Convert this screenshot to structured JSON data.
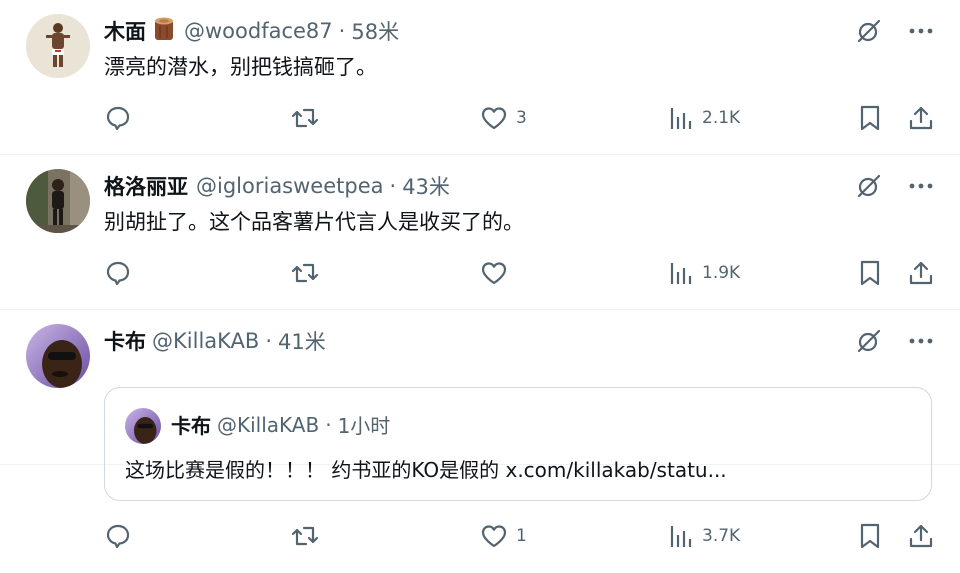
{
  "colors": {
    "text": "#0f1419",
    "secondary": "#536471",
    "border": "#eff3f4",
    "quote_border": "#cfd9de"
  },
  "tweets": [
    {
      "display_name": "木面",
      "handle": "@woodface87",
      "separator": "·",
      "time": "58米",
      "text": "漂亮的潜水，别把钱搞砸了。",
      "stats": {
        "reply": "",
        "retweet": "",
        "like": "3",
        "views": "2.1K"
      }
    },
    {
      "display_name": "格洛丽亚",
      "handle": "@igloriasweetpea",
      "separator": "·",
      "time": "43米",
      "text": "别胡扯了。这个品客薯片代言人是收买了的。",
      "stats": {
        "reply": "",
        "retweet": "",
        "like": "",
        "views": "1.9K"
      }
    },
    {
      "display_name": "卡布",
      "handle": "@KillaKAB",
      "separator": "·",
      "time": "41米",
      "quote": {
        "display_name": "卡布",
        "handle": "@KillaKAB",
        "separator": "·",
        "time": "1小时",
        "text": "这场比赛是假的！！！ 约书亚的KO是假的 x.com/killakab/statu..."
      },
      "stats": {
        "reply": "",
        "retweet": "",
        "like": "1",
        "views": "3.7K"
      }
    }
  ],
  "icons": {
    "grok": "grok-slash-circle-icon",
    "more": "more-dots-icon",
    "reply": "reply-bubble-icon",
    "retweet": "retweet-arrows-icon",
    "like": "heart-icon",
    "views": "bar-chart-icon",
    "bookmark": "bookmark-icon",
    "share": "share-upload-icon"
  }
}
